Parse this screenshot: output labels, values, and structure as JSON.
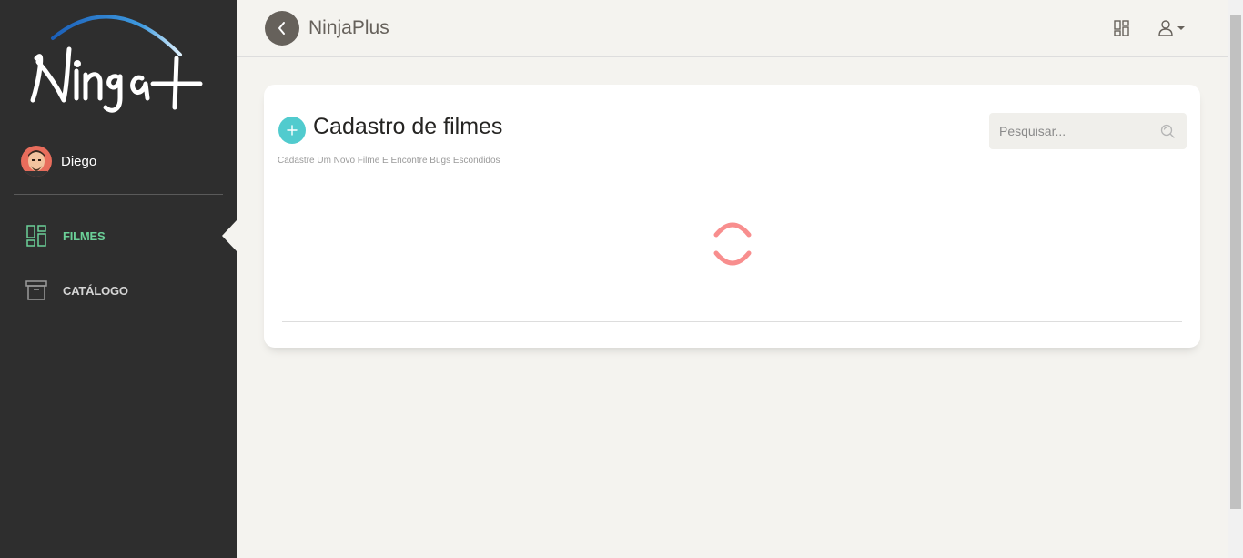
{
  "sidebar": {
    "logo_text": "Ninja+",
    "user": {
      "name": "Diego"
    },
    "nav": [
      {
        "label": "FILMES",
        "icon": "dashboard-grid-icon",
        "active": true
      },
      {
        "label": "CATÁLOGO",
        "icon": "archive-box-icon",
        "active": false
      }
    ]
  },
  "header": {
    "brand": "NinjaPlus",
    "back_icon": "chevron-left-icon",
    "grid_icon": "grid-layout-icon",
    "user_menu_icon": "user-icon"
  },
  "card": {
    "title": "Cadastro de filmes",
    "subtitle": "Cadastre Um Novo Filme E Encontre Bugs Escondidos",
    "add_icon": "plus-icon",
    "search": {
      "placeholder": "Pesquisar...",
      "value": "",
      "icon": "search-icon"
    },
    "loading": true
  },
  "colors": {
    "sidebar_bg": "#2e2e2e",
    "accent_green": "#6bd098",
    "accent_cyan": "#51cbce",
    "spinner": "#f88e8e",
    "page_bg": "#f4f3ef"
  }
}
